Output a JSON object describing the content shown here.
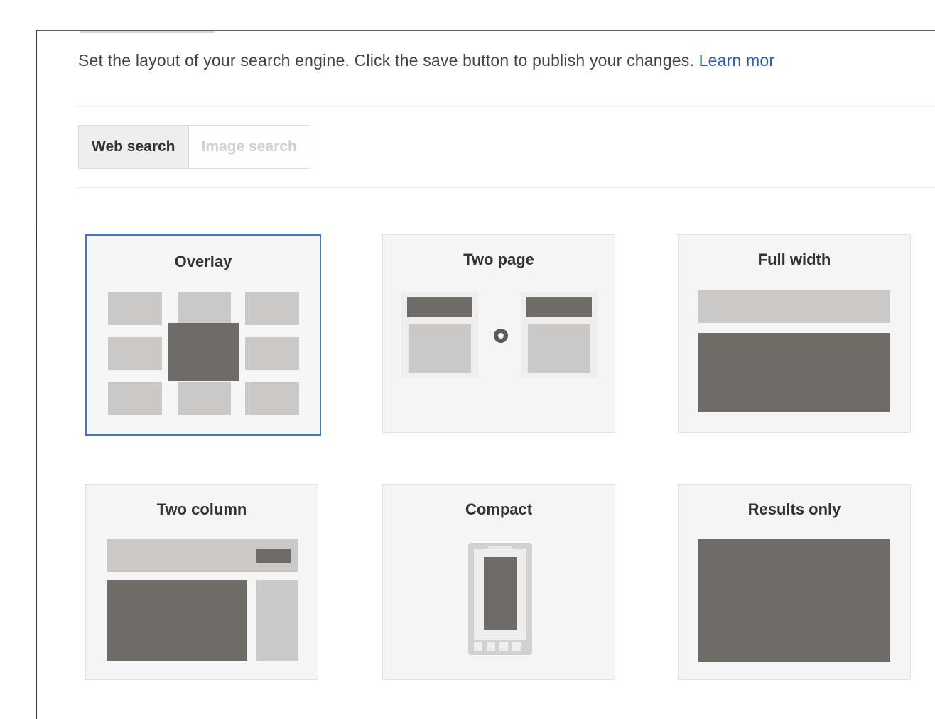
{
  "description": {
    "text": "Set the layout of your search engine. Click the save button to publish your changes.",
    "link_label": "Learn mor"
  },
  "tabs": [
    {
      "label": "Web search",
      "active": true
    },
    {
      "label": "Image search",
      "active": false
    }
  ],
  "layouts": [
    {
      "label": "Overlay",
      "selected": true
    },
    {
      "label": "Two page",
      "selected": false
    },
    {
      "label": "Full width",
      "selected": false
    },
    {
      "label": "Two column",
      "selected": false
    },
    {
      "label": "Compact",
      "selected": false
    },
    {
      "label": "Results only",
      "selected": false
    }
  ],
  "colors": {
    "selected_border": "#3b7cc4",
    "link": "#2a5bb5",
    "dark_block": "#6f6b67",
    "light_block": "#cbc9c7"
  }
}
